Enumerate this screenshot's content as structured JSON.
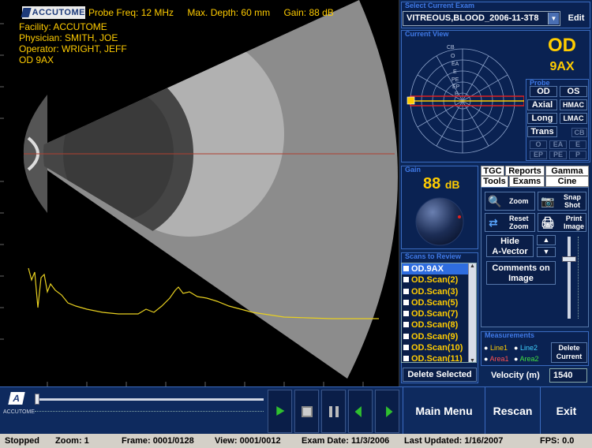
{
  "header": {
    "brand": "ACCUTOME",
    "probe_freq": "Probe Freq: 12 MHz",
    "max_depth": "Max. Depth: 60 mm",
    "gain": "Gain: 88 dB"
  },
  "patient": {
    "facility": "Facility: ACCUTOME",
    "physician": "Physician: SMITH, JOE",
    "operator": "Operator: WRIGHT, JEFF",
    "eye": "OD  9AX"
  },
  "current_exam": {
    "title": "Select Current Exam",
    "value": "VITREOUS,BLOOD_2006-11-3T8",
    "edit_label": "Edit"
  },
  "current_view": {
    "title": "Current View",
    "eye": "OD",
    "position": "9AX",
    "clock_labels": [
      "CB",
      "O",
      "EA",
      "E",
      "PE",
      "EP",
      "P"
    ]
  },
  "probe": {
    "title": "Probe",
    "od": "OD",
    "os": "OS",
    "axial": "Axial",
    "hmac": "HMAC",
    "long": "Long",
    "lmac": "LMAC",
    "trans": "Trans",
    "cb": "CB",
    "o": "O",
    "ea": "EA",
    "e": "E",
    "ep": "EP",
    "pe": "PE",
    "p": "P"
  },
  "gain": {
    "title": "Gain",
    "value": "88",
    "unit": "dB"
  },
  "tabs": {
    "tgc": "TGC",
    "reports": "Reports",
    "gamma": "Gamma",
    "tools": "Tools",
    "exams": "Exams",
    "cine": "Cine"
  },
  "tools": {
    "zoom": "Zoom",
    "snap_shot_1": "Snap",
    "snap_shot_2": "Shot",
    "reset_zoom_1": "Reset",
    "reset_zoom_2": "Zoom",
    "print_image_1": "Print",
    "print_image_2": "Image",
    "hide_avector_1": "Hide",
    "hide_avector_2": "A-Vector",
    "comments_1": "Comments on",
    "comments_2": "Image"
  },
  "scans": {
    "title": "Scans to Review",
    "items": [
      "OD.9AX",
      "OD.Scan(2)",
      "OD.Scan(3)",
      "OD.Scan(5)",
      "OD.Scan(7)",
      "OD.Scan(8)",
      "OD.Scan(9)",
      "OD.Scan(10)",
      "OD.Scan(11)"
    ],
    "delete_label": "Delete Selected"
  },
  "measurements": {
    "title": "Measurements",
    "line1": "Line1",
    "line2": "Line2",
    "area1": "Area1",
    "area2": "Area2",
    "delete_1": "Delete",
    "delete_2": "Current",
    "velocity_label": "Velocity (m)",
    "velocity_value": "1540"
  },
  "bottom": {
    "brand": "ACCUTOME",
    "main_menu": "Main Menu",
    "rescan": "Rescan",
    "exit": "Exit"
  },
  "status": {
    "state": "Stopped",
    "zoom": "Zoom: 1",
    "frame": "Frame: 0001/0128",
    "view": "View: 0001/0012",
    "exam_date": "Exam Date: 11/3/2006",
    "last_updated": "Last Updated: 1/16/2007",
    "fps": "FPS: 0.0"
  },
  "colors": {
    "accent_yellow": "#ffcc00",
    "panel_blue": "#0c2758",
    "title_blue": "#3f7ae8",
    "marker_red": "#e02020"
  }
}
